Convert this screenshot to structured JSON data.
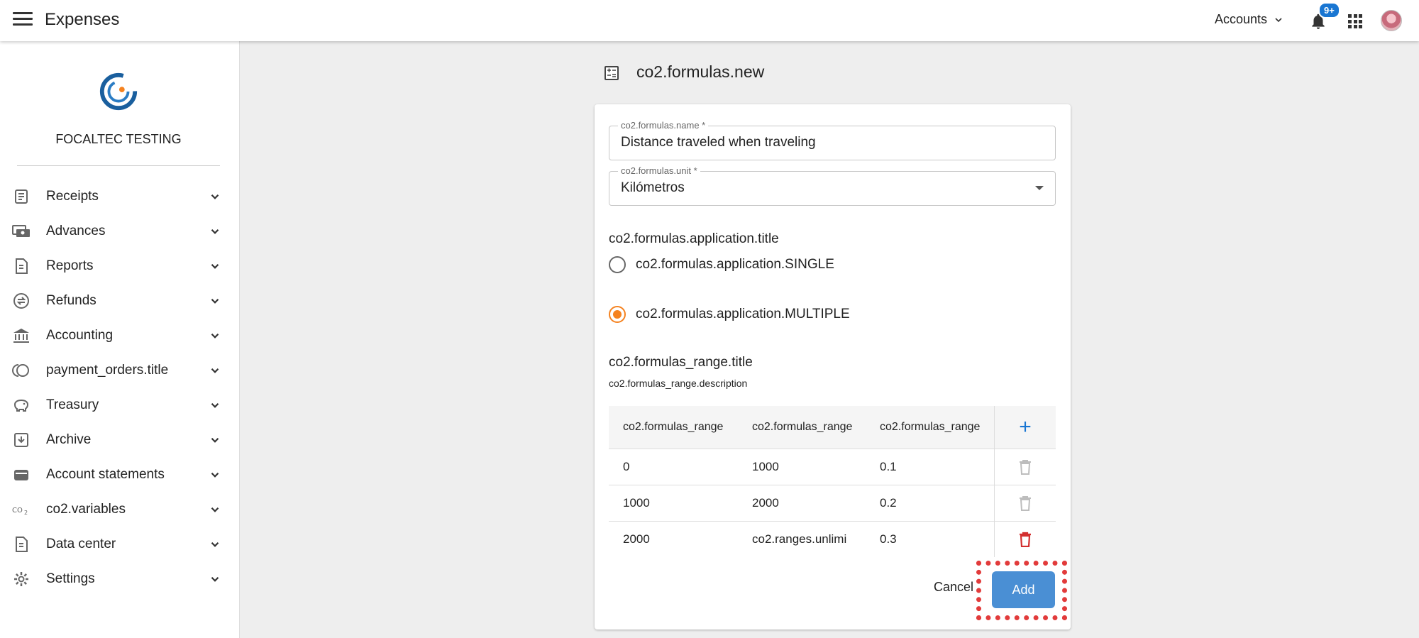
{
  "header": {
    "app_title": "Expenses",
    "accounts_label": "Accounts",
    "notification_badge": "9+",
    "icons": [
      "menu-icon",
      "chevron-down-icon",
      "bell-icon",
      "apps-grid-icon",
      "avatar"
    ]
  },
  "sidebar": {
    "company": "FOCALTEC TESTING",
    "items": [
      {
        "label": "Receipts",
        "icon": "receipt-icon"
      },
      {
        "label": "Advances",
        "icon": "cash-icon"
      },
      {
        "label": "Reports",
        "icon": "report-icon"
      },
      {
        "label": "Refunds",
        "icon": "refund-icon"
      },
      {
        "label": "Accounting",
        "icon": "bank-icon"
      },
      {
        "label": "payment_orders.title",
        "icon": "payment-orders-icon"
      },
      {
        "label": "Treasury",
        "icon": "piggy-bank-icon"
      },
      {
        "label": "Archive",
        "icon": "archive-icon"
      },
      {
        "label": "Account statements",
        "icon": "wallet-icon"
      },
      {
        "label": "co2.variables",
        "icon": "co2-icon"
      },
      {
        "label": "Data center",
        "icon": "data-center-icon"
      },
      {
        "label": "Settings",
        "icon": "gear-icon"
      }
    ]
  },
  "main": {
    "page_title": "co2.formulas.new",
    "name_field": {
      "label": "co2.formulas.name *",
      "value": "Distance traveled when traveling"
    },
    "unit_field": {
      "label": "co2.formulas.unit *",
      "value": "Kilómetros"
    },
    "application": {
      "title": "co2.formulas.application.title",
      "options": [
        {
          "label": "co2.formulas.application.SINGLE",
          "checked": false
        },
        {
          "label": "co2.formulas.application.MULTIPLE",
          "checked": true
        }
      ]
    },
    "range": {
      "title": "co2.formulas_range.title",
      "description": "co2.formulas_range.description",
      "headers": [
        "co2.formulas_range",
        "co2.formulas_range",
        "co2.formulas_range"
      ],
      "rows": [
        {
          "from": "0",
          "to": "1000",
          "factor": "0.1",
          "delete_active": false
        },
        {
          "from": "1000",
          "to": "2000",
          "factor": "0.2",
          "delete_active": false
        },
        {
          "from": "2000",
          "to": "co2.ranges.unlimi",
          "factor": "0.3",
          "delete_active": true
        }
      ]
    },
    "actions": {
      "cancel": "Cancel",
      "add": "Add"
    },
    "colors": {
      "accent": "#f5821f",
      "primary": "#4a8fd4",
      "delete_active": "#d32f2f",
      "highlight": "#e23b3b"
    }
  }
}
